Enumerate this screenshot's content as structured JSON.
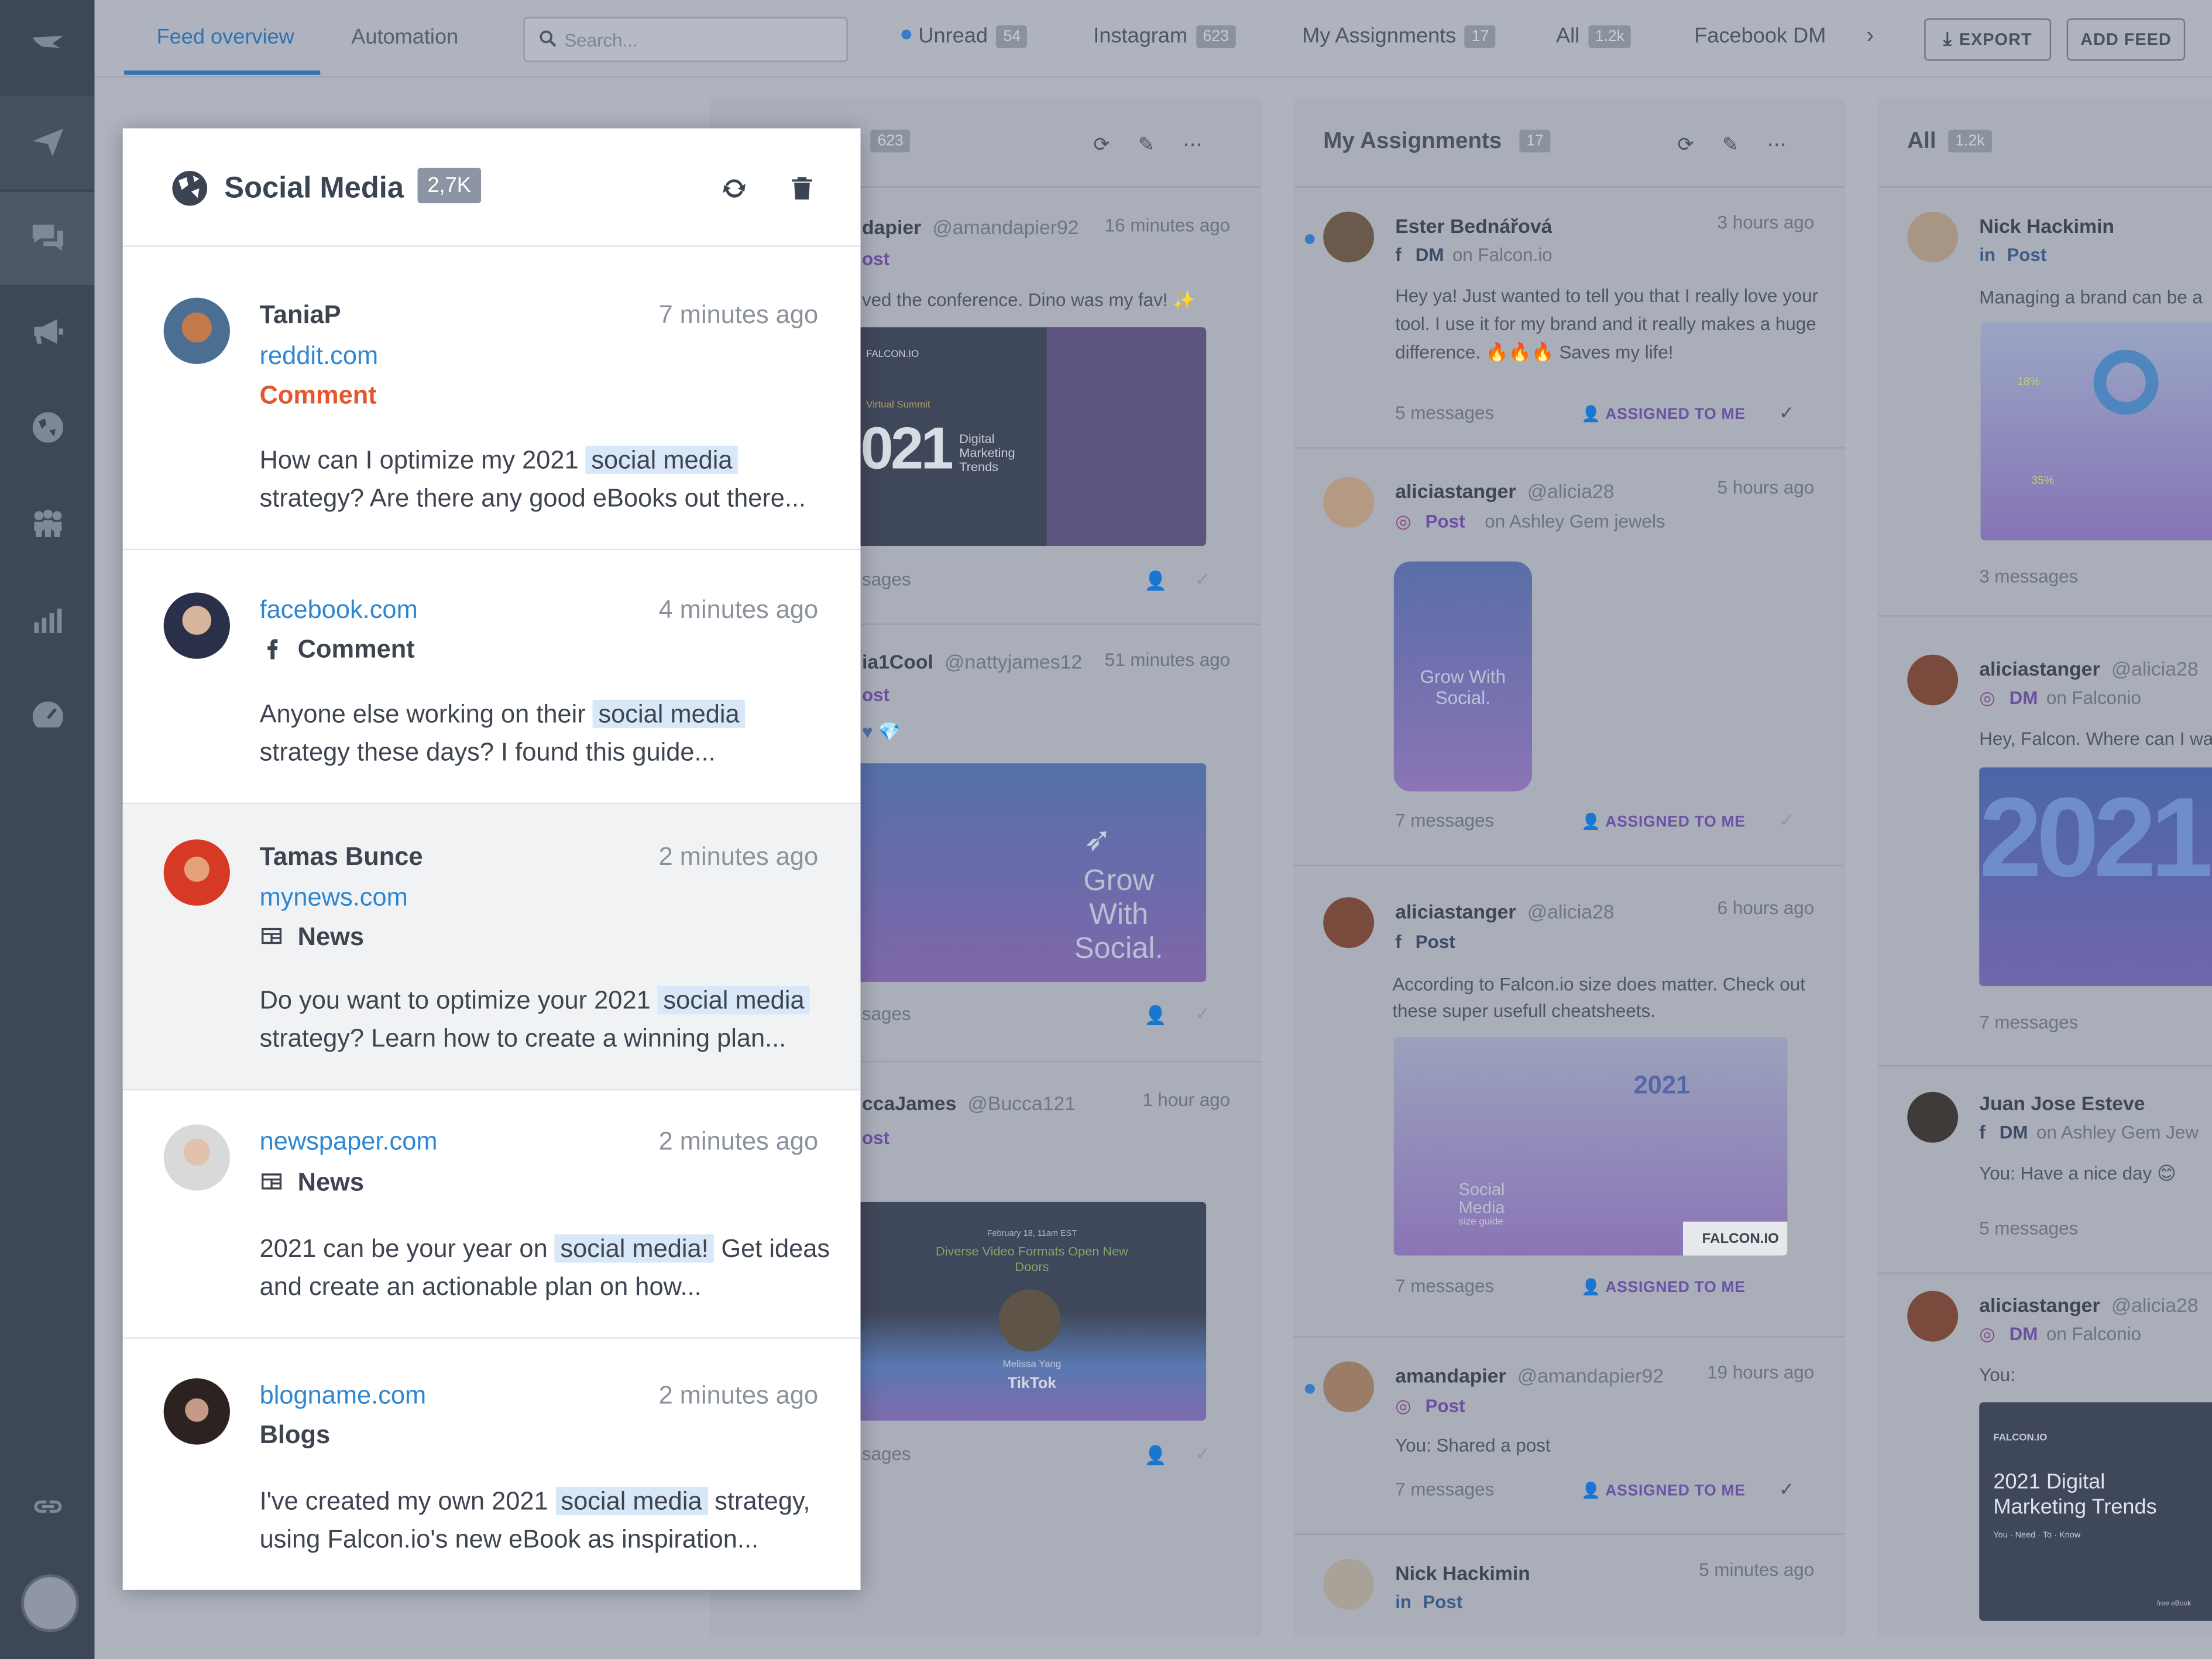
{
  "topbar": {
    "tabs": [
      "Feed overview",
      "Automation"
    ],
    "search_placeholder": "Search...",
    "feed_tabs": [
      {
        "label": "Unread",
        "count": "54"
      },
      {
        "label": "Instagram",
        "count": "623"
      },
      {
        "label": "My Assignments",
        "count": "17"
      },
      {
        "label": "All",
        "count": "1.2k"
      },
      {
        "label": "Facebook DM",
        "count": ""
      }
    ],
    "export_label": "EXPORT",
    "add_feed_label": "ADD FEED"
  },
  "columns": {
    "instagram": {
      "count": "623",
      "cards": [
        {
          "name": "dapier",
          "handle": "@amandapier92",
          "time": "16 minutes ago",
          "type": "ost",
          "text": "ved the conference. Dino was my fav! ✨",
          "meta": "sages",
          "img_caption": "Digital Marketing Trends",
          "img_brand": "FALCON.IO",
          "img_year": "021",
          "img_sub": "Virtual Summit"
        },
        {
          "name": "ia1Cool",
          "handle": "@nattyjames12",
          "time": "51 minutes ago",
          "type": "ost",
          "text": "♥ 💎",
          "meta": "sages",
          "img_title": "Grow With Social."
        },
        {
          "name": "ccaJames",
          "handle": "@Bucca121",
          "time": "1 hour ago",
          "type": "ost",
          "meta": "sages",
          "img_date": "February 18, 11am EST",
          "img_title": "Diverse Video Formats Open New Doors",
          "img_person": "Melissa Yang",
          "img_brand": "TikTok"
        }
      ]
    },
    "assignments": {
      "title": "My Assignments",
      "count": "17",
      "cards": [
        {
          "name": "Ester Bednářová",
          "time": "3 hours ago",
          "type": "DM",
          "on": "on Falcon.io",
          "text": "Hey ya! Just wanted to tell you that I really love your tool. I use it for my brand and it really makes a huge difference. 🔥🔥🔥 Saves my life!",
          "meta": "5 messages",
          "assigned": "ASSIGNED TO ME"
        },
        {
          "name": "aliciastanger",
          "handle": "@alicia28",
          "time": "5 hours ago",
          "type": "Post",
          "on": "on Ashley Gem jewels",
          "meta": "7 messages",
          "assigned": "ASSIGNED TO ME",
          "img_title": "Grow With Social."
        },
        {
          "name": "aliciastanger",
          "handle": "@alicia28",
          "time": "6 hours ago",
          "type": "Post",
          "text": "According to Falcon.io size does matter. Check out these super usefull cheatsheets.",
          "meta": "7 messages",
          "assigned": "ASSIGNED TO ME",
          "img_year": "2021",
          "img_title": "Social Media",
          "img_sub": "size guide",
          "img_brand": "FALCON.IO"
        },
        {
          "name": "amandapier",
          "handle": "@amandapier92",
          "time": "19 hours ago",
          "type": "Post",
          "text": "You: Shared a post",
          "meta": "7 messages",
          "assigned": "ASSIGNED TO ME"
        },
        {
          "name": "Nick Hackimin",
          "time": "5 minutes ago",
          "type": "Post"
        }
      ]
    },
    "all": {
      "title": "All",
      "count": "1.2k",
      "cards": [
        {
          "name": "Nick Hackimin",
          "type": "Post",
          "text": "Managing a brand can be a",
          "meta": "3 messages",
          "img_a": "18%",
          "img_b": "35%"
        },
        {
          "name": "aliciastanger",
          "handle": "@alicia28",
          "type": "DM",
          "on": "on Falconio",
          "text": "Hey, Falcon. Where can I wa",
          "meta": "7 messages",
          "img_year": "2021"
        },
        {
          "name": "Juan Jose Esteve",
          "type": "DM",
          "on": "on Ashley Gem Jew",
          "text": "You: Have a nice day 😊",
          "meta": "5 messages"
        },
        {
          "name": "aliciastanger",
          "handle": "@alicia28",
          "type": "DM",
          "on": "on Falconio",
          "text": "You:",
          "img_brand": "FALCON.IO",
          "img_title": "2021 Digital Marketing Trends",
          "img_words": [
            "You",
            "Need",
            "To",
            "Know"
          ],
          "img_tag": "free eBook"
        }
      ]
    }
  },
  "popup": {
    "title": "Social Media",
    "badge": "2,7K",
    "items": [
      {
        "name": "TaniaP",
        "time": "7 minutes ago",
        "source": "reddit.com",
        "type": "Comment",
        "text_before": "How can I optimize my 2021 ",
        "highlight": "social media",
        "text_after": " strategy? Are there any good eBooks out there..."
      },
      {
        "name": "",
        "time": "4 minutes ago",
        "source": "facebook.com",
        "type": "Comment",
        "text_before": "Anyone else working on their ",
        "highlight": "social media",
        "text_after": " strategy these days? I found this guide..."
      },
      {
        "name": "Tamas Bunce",
        "time": "2 minutes ago",
        "source": "mynews.com",
        "type": "News",
        "text_before": "Do you want to optimize your 2021 ",
        "highlight": "social media",
        "text_after": " strategy? Learn how to create a winning plan..."
      },
      {
        "name": "",
        "time": "2 minutes ago",
        "source": "newspaper.com",
        "type": "News",
        "text_before": "2021 can be your year on ",
        "highlight": "social media!",
        "text_after": " Get ideas and create an actionable plan on how..."
      },
      {
        "name": "",
        "time": "2 minutes ago",
        "source": "blogname.com",
        "type": "Blogs",
        "text_before": "I've created my own 2021 ",
        "highlight": "social media",
        "text_after": " strategy, using Falcon.io's new eBook as inspiration..."
      }
    ]
  },
  "icons": {
    "rail": [
      "falcon-logo-icon",
      "paper-plane-icon",
      "chat-bubbles-icon",
      "megaphone-icon",
      "globe-icon",
      "team-icon",
      "bar-chart-icon",
      "speedometer-icon",
      "link-icon"
    ],
    "popup": [
      "globe-icon",
      "refresh-icon",
      "trash-icon",
      "facebook-icon",
      "newspaper-icon"
    ]
  },
  "colors": {
    "accent": "#2e86d1",
    "comment_red": "#e4572e",
    "assigned_purple": "#6a52a7",
    "rail": "#3e4757"
  }
}
